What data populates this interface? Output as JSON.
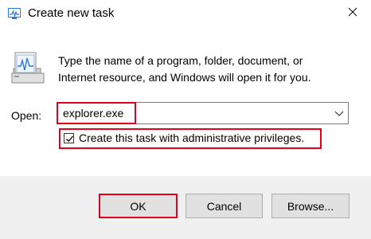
{
  "window": {
    "title": "Create new task",
    "icon": "task-manager-icon",
    "close_icon": "close-icon"
  },
  "prompt": {
    "icon": "run-program-icon",
    "line1": "Type the name of a program, folder, document, or",
    "line2": "Internet resource, and Windows will open it for you."
  },
  "open": {
    "label": "Open:",
    "value": "explorer.exe",
    "dropdown_icon": "chevron-down-icon"
  },
  "admin_option": {
    "label": "Create this task with administrative privileges.",
    "checked": true
  },
  "buttons": {
    "ok": "OK",
    "cancel": "Cancel",
    "browse": "Browse..."
  },
  "colors": {
    "highlight": "#e3001b",
    "footer_bg": "#f0f0f0",
    "button_bg": "#e1e1e1",
    "icon_blue": "#2b79d8"
  }
}
